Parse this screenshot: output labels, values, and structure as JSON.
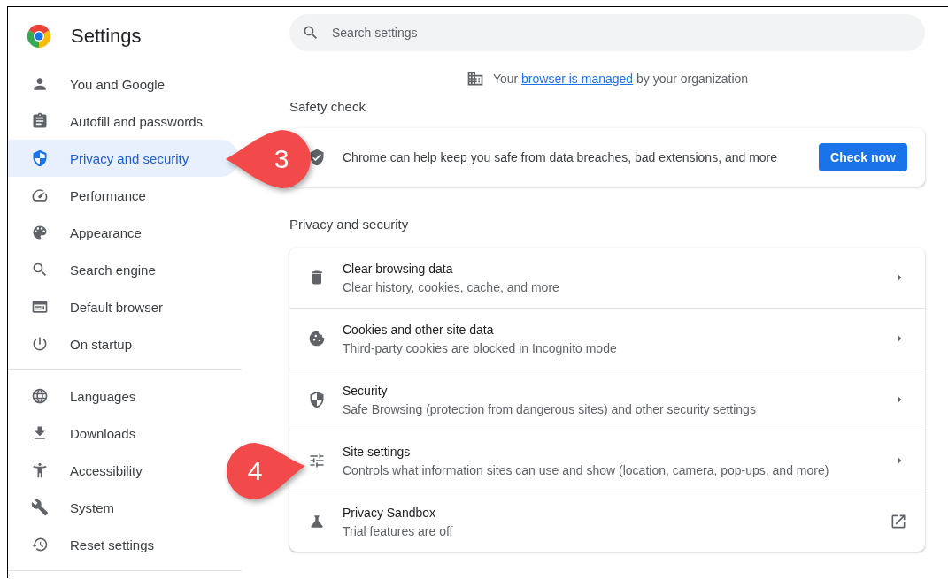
{
  "header": {
    "title": "Settings",
    "search": {
      "placeholder": "Search settings"
    }
  },
  "sidebar": {
    "sections": [
      {
        "items": [
          {
            "label": "You and Google",
            "selected": false
          },
          {
            "label": "Autofill and passwords",
            "selected": false
          },
          {
            "label": "Privacy and security",
            "selected": true
          },
          {
            "label": "Performance",
            "selected": false
          },
          {
            "label": "Appearance",
            "selected": false
          },
          {
            "label": "Search engine",
            "selected": false
          },
          {
            "label": "Default browser",
            "selected": false
          },
          {
            "label": "On startup",
            "selected": false
          }
        ]
      },
      {
        "items": [
          {
            "label": "Languages",
            "selected": false
          },
          {
            "label": "Downloads",
            "selected": false
          },
          {
            "label": "Accessibility",
            "selected": false
          },
          {
            "label": "System",
            "selected": false
          },
          {
            "label": "Reset settings",
            "selected": false
          }
        ]
      }
    ]
  },
  "managed_notice": {
    "before": "Your",
    "link": "browser is managed",
    "after": "by your organization"
  },
  "safety_check": {
    "title": "Safety check",
    "text": "Chrome can help keep you safe from data breaches, bad extensions, and more",
    "button": "Check now"
  },
  "privacy": {
    "title": "Privacy and security",
    "rows": [
      {
        "title": "Clear browsing data",
        "subtitle": "Clear history, cookies, cache, and more",
        "kind": "submenu"
      },
      {
        "title": "Cookies and other site data",
        "subtitle": "Third-party cookies are blocked in Incognito mode",
        "kind": "submenu"
      },
      {
        "title": "Security",
        "subtitle": "Safe Browsing (protection from dangerous sites) and other security settings",
        "kind": "submenu"
      },
      {
        "title": "Site settings",
        "subtitle": "Controls what information sites can use and show (location, camera, pop-ups, and more)",
        "kind": "submenu"
      },
      {
        "title": "Privacy Sandbox",
        "subtitle": "Trial features are off",
        "kind": "external"
      }
    ]
  },
  "callouts": [
    {
      "label": "3"
    },
    {
      "label": "4"
    }
  ]
}
